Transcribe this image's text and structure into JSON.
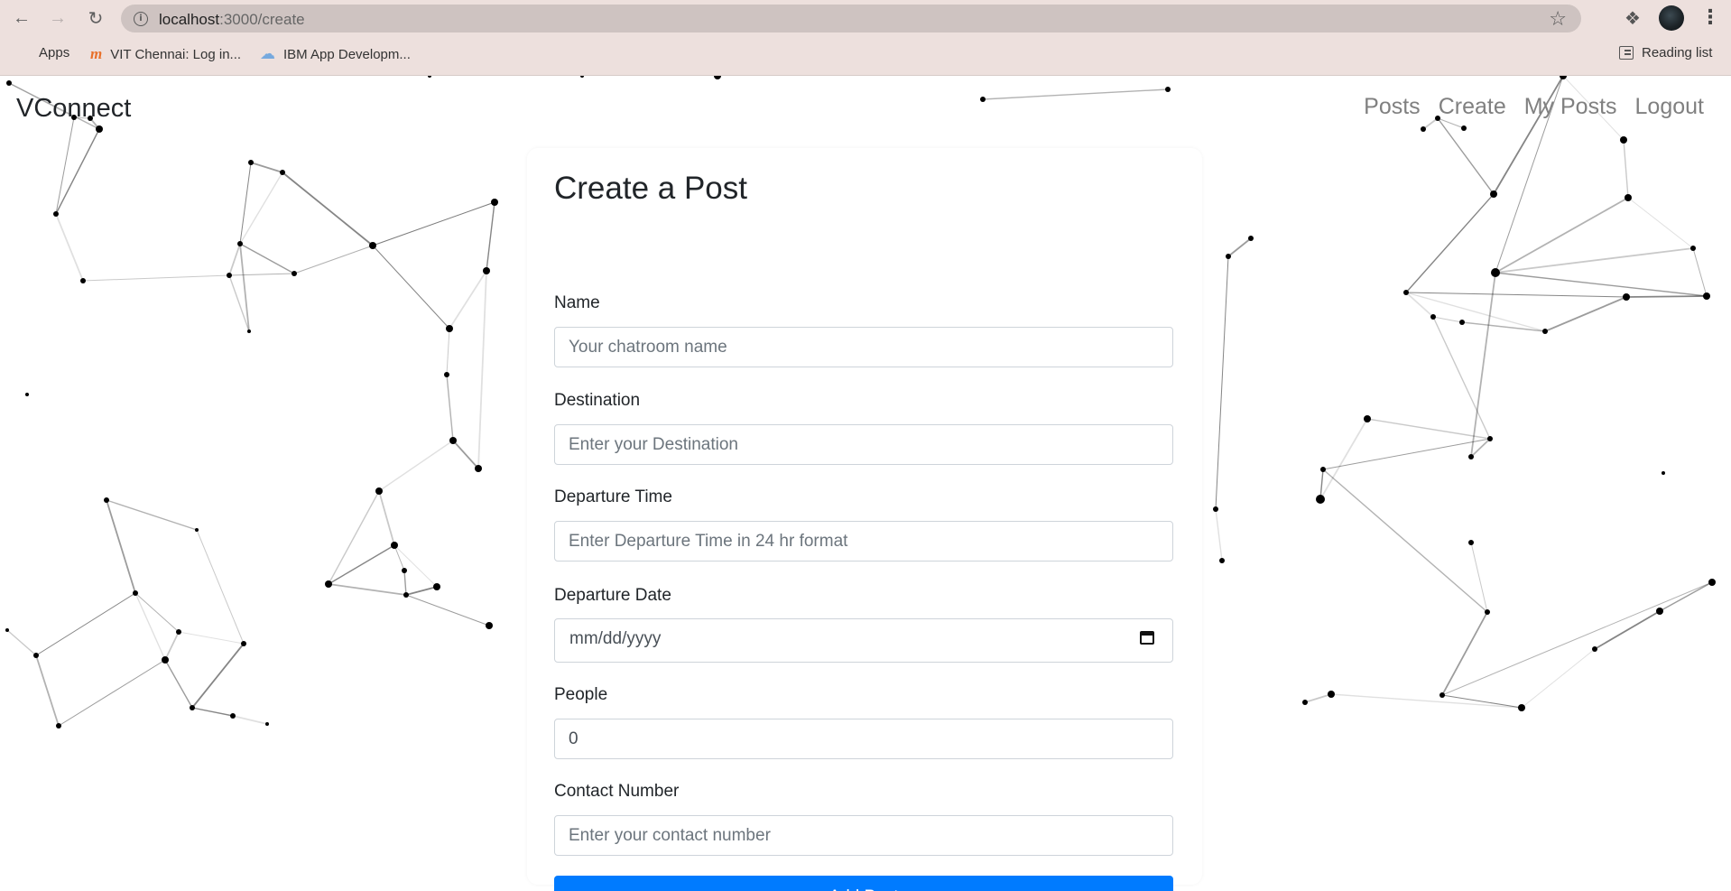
{
  "browser": {
    "url_host": "localhost",
    "url_path": ":3000/create",
    "bookmarks": [
      {
        "label": "Apps",
        "icon": "apps-grid-icon"
      },
      {
        "label": "VIT Chennai: Log in...",
        "icon": "moodle-icon"
      },
      {
        "label": "IBM App Developm...",
        "icon": "cloud-icon"
      }
    ],
    "reading_list": "Reading list"
  },
  "navbar": {
    "brand": "VConnect",
    "links": [
      "Posts",
      "Create",
      "My Posts",
      "Logout"
    ]
  },
  "form": {
    "title": "Create a Post",
    "fields": {
      "name": {
        "label": "Name",
        "placeholder": "Your chatroom name"
      },
      "destination": {
        "label": "Destination",
        "placeholder": "Enter your Destination"
      },
      "departure_time": {
        "label": "Departure Time",
        "placeholder": "Enter Departure Time in 24 hr format"
      },
      "departure_date": {
        "label": "Departure Date",
        "value": "mm/dd/yyyy"
      },
      "people": {
        "label": "People",
        "value": "0"
      },
      "contact": {
        "label": "Contact Number",
        "placeholder": "Enter your contact number"
      }
    },
    "submit": "Add Post"
  },
  "colors": {
    "primary_button": "#007bff",
    "chrome_background": "#ede0dd",
    "omnibox_background": "#cec3c1",
    "nav_link": "#808080"
  }
}
